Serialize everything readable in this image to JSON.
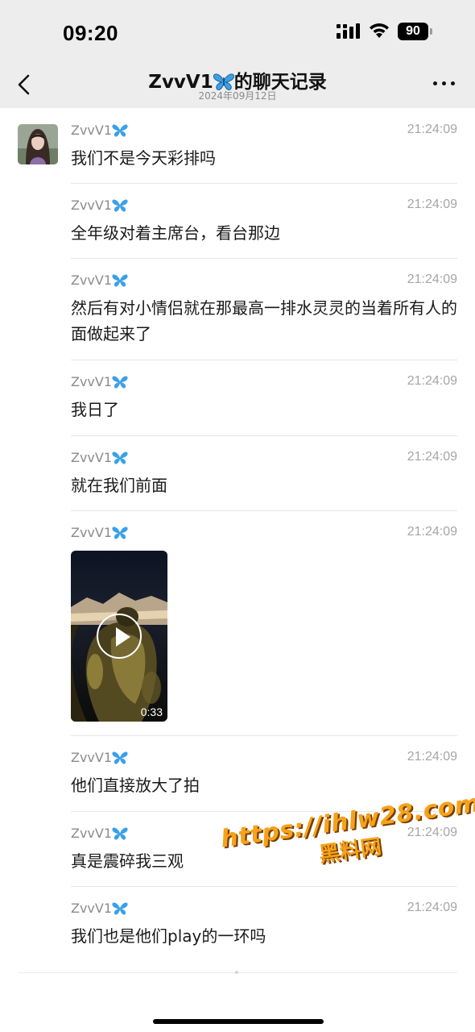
{
  "status_bar": {
    "time": "09:20",
    "battery": "90",
    "icons": [
      "cellular-signal-icon",
      "wifi-icon",
      "battery-icon"
    ]
  },
  "nav": {
    "title_name": "ZvvV1",
    "title_suffix": "的聊天记录",
    "subtitle": "2024年09月12日",
    "back_icon": "chevron-left-icon",
    "more_icon": "ellipsis-icon"
  },
  "messages": [
    {
      "sender": "ZvvV1",
      "time": "21:24:09",
      "text": "我们不是今天彩排吗"
    },
    {
      "sender": "ZvvV1",
      "time": "21:24:09",
      "text": "全年级对着主席台，看台那边"
    },
    {
      "sender": "ZvvV1",
      "time": "21:24:09",
      "text": "然后有对小情侣就在那最高一排水灵灵的当着所有人的面做起来了"
    },
    {
      "sender": "ZvvV1",
      "time": "21:24:09",
      "text": "我日了"
    },
    {
      "sender": "ZvvV1",
      "time": "21:24:09",
      "text": "就在我们前面"
    },
    {
      "sender": "ZvvV1",
      "time": "21:24:09",
      "type": "video",
      "duration": "0:33"
    },
    {
      "sender": "ZvvV1",
      "time": "21:24:09",
      "text": "他们直接放大了拍"
    },
    {
      "sender": "ZvvV1",
      "time": "21:24:09",
      "text": "真是震碎我三观"
    },
    {
      "sender": "ZvvV1",
      "time": "21:24:09",
      "text": "我们也是他们play的一环吗"
    }
  ],
  "watermark": {
    "url": "https://ihlw28.com",
    "name": "黑料网"
  },
  "colors": {
    "header_bg": "#ededed",
    "butterfly": "#3aa0e8",
    "watermark": "#f6a21a"
  }
}
